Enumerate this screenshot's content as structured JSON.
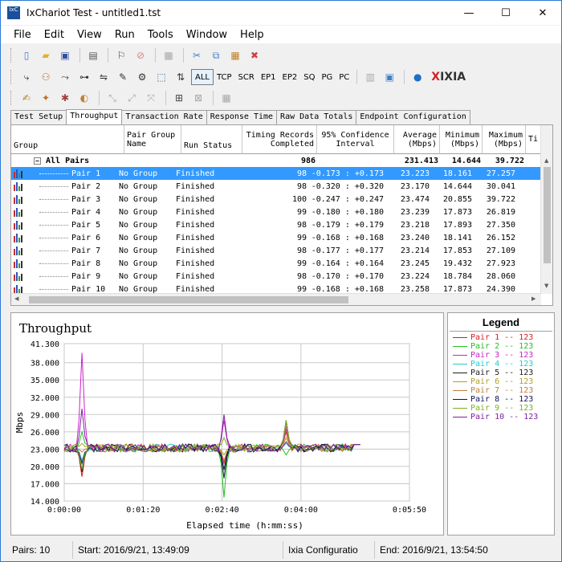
{
  "window": {
    "title": "IxChariot Test - untitled1.tst",
    "app_icon_text": "IxC",
    "minimize": "—",
    "maximize": "☐",
    "close": "✕"
  },
  "menu": [
    "File",
    "Edit",
    "View",
    "Run",
    "Tools",
    "Window",
    "Help"
  ],
  "protocols": [
    "ALL",
    "TCP",
    "SCR",
    "EP1",
    "EP2",
    "SQ",
    "PG",
    "PC"
  ],
  "brand": {
    "x": "X",
    "rest": "IXIA"
  },
  "tabs": [
    "Test Setup",
    "Throughput",
    "Transaction Rate",
    "Response Time",
    "Raw Data Totals",
    "Endpoint Configuration"
  ],
  "active_tab": "Throughput",
  "grid": {
    "headers": {
      "group": "Group",
      "pair_group_name": [
        "Pair Group",
        "Name"
      ],
      "run_status": "Run Status",
      "timing_records": [
        "Timing Records",
        "Completed"
      ],
      "confidence": [
        "95% Confidence",
        "Interval"
      ],
      "average": [
        "Average",
        "(Mbps)"
      ],
      "minimum": [
        "Minimum",
        "(Mbps)"
      ],
      "maximum": [
        "Maximum",
        "(Mbps)"
      ],
      "extra": "Ti"
    },
    "summary": {
      "expander": "−",
      "label": "All Pairs",
      "records": "986",
      "average": "231.413",
      "minimum": "14.644",
      "maximum": "39.722"
    },
    "rows": [
      {
        "pair": "Pair 1",
        "group": "No Group",
        "status": "Finished",
        "records": "98",
        "ci": "-0.173 : +0.173",
        "avg": "23.223",
        "min": "18.161",
        "max": "27.257"
      },
      {
        "pair": "Pair 2",
        "group": "No Group",
        "status": "Finished",
        "records": "98",
        "ci": "-0.320 : +0.320",
        "avg": "23.170",
        "min": "14.644",
        "max": "30.041"
      },
      {
        "pair": "Pair 3",
        "group": "No Group",
        "status": "Finished",
        "records": "100",
        "ci": "-0.247 : +0.247",
        "avg": "23.474",
        "min": "20.855",
        "max": "39.722"
      },
      {
        "pair": "Pair 4",
        "group": "No Group",
        "status": "Finished",
        "records": "99",
        "ci": "-0.180 : +0.180",
        "avg": "23.239",
        "min": "17.873",
        "max": "26.819"
      },
      {
        "pair": "Pair 5",
        "group": "No Group",
        "status": "Finished",
        "records": "98",
        "ci": "-0.179 : +0.179",
        "avg": "23.218",
        "min": "17.893",
        "max": "27.350"
      },
      {
        "pair": "Pair 6",
        "group": "No Group",
        "status": "Finished",
        "records": "99",
        "ci": "-0.168 : +0.168",
        "avg": "23.240",
        "min": "18.141",
        "max": "26.152"
      },
      {
        "pair": "Pair 7",
        "group": "No Group",
        "status": "Finished",
        "records": "98",
        "ci": "-0.177 : +0.177",
        "avg": "23.214",
        "min": "17.853",
        "max": "27.109"
      },
      {
        "pair": "Pair 8",
        "group": "No Group",
        "status": "Finished",
        "records": "99",
        "ci": "-0.164 : +0.164",
        "avg": "23.245",
        "min": "19.432",
        "max": "27.923"
      },
      {
        "pair": "Pair 9",
        "group": "No Group",
        "status": "Finished",
        "records": "98",
        "ci": "-0.170 : +0.170",
        "avg": "23.224",
        "min": "18.784",
        "max": "28.060"
      },
      {
        "pair": "Pair 10",
        "group": "No Group",
        "status": "Finished",
        "records": "99",
        "ci": "-0.168 : +0.168",
        "avg": "23.258",
        "min": "17.873",
        "max": "24.390"
      }
    ],
    "selected_row": 0
  },
  "legend": {
    "title": "Legend",
    "items": [
      {
        "label": "Pair 1 -- 123",
        "color": "#d42020"
      },
      {
        "label": "Pair 2 -- 123",
        "color": "#22c022"
      },
      {
        "label": "Pair 3 -- 123",
        "color": "#cc22cc"
      },
      {
        "label": "Pair 4 -- 123",
        "color": "#22cccc"
      },
      {
        "label": "Pair 5 -- 123",
        "color": "#202020"
      },
      {
        "label": "Pair 6 -- 123",
        "color": "#b0a020"
      },
      {
        "label": "Pair 7 -- 123",
        "color": "#c08040"
      },
      {
        "label": "Pair 8 -- 123",
        "color": "#101060"
      },
      {
        "label": "Pair 9 -- 123",
        "color": "#80b020"
      },
      {
        "label": "Pair 10 -- 123",
        "color": "#8020a0"
      }
    ]
  },
  "chart_data": {
    "type": "line",
    "title": "Throughput",
    "xlabel": "Elapsed time (h:mm:ss)",
    "ylabel": "Mbps",
    "yticks": [
      "41.300",
      "38.000",
      "35.000",
      "32.000",
      "29.000",
      "26.000",
      "23.000",
      "20.000",
      "17.000",
      "14.000"
    ],
    "ytick_values": [
      41.3,
      38,
      35,
      32,
      29,
      26,
      23,
      20,
      17,
      14
    ],
    "xticks": [
      "0:00:00",
      "0:01:20",
      "0:02:40",
      "0:04:00",
      "0:05:50"
    ],
    "xtick_values": [
      0,
      80,
      160,
      240,
      350
    ],
    "ylim": [
      14,
      41.3
    ],
    "xlim": [
      0,
      350
    ],
    "grid": true,
    "baseline": 23.2,
    "spikes": [
      {
        "t": 18,
        "values": [
          18.2,
          26.0,
          39.7,
          21.0,
          19.0,
          24.0,
          22.5,
          20.5,
          19.5,
          30.0
        ]
      },
      {
        "t": 162,
        "values": [
          20.5,
          14.6,
          28.0,
          17.9,
          18.0,
          22.0,
          21.0,
          19.4,
          25.0,
          29.0
        ]
      },
      {
        "t": 225,
        "values": [
          26.0,
          22.0,
          26.5,
          24.0,
          28.0,
          25.0,
          27.0,
          27.9,
          28.0,
          24.3
        ]
      }
    ]
  },
  "status": {
    "pairs": "Pairs: 10",
    "start": "Start: 2016/9/21, 13:49:09",
    "config": "Ixia Configuratio",
    "end": "End: 2016/9/21, 13:54:50"
  }
}
